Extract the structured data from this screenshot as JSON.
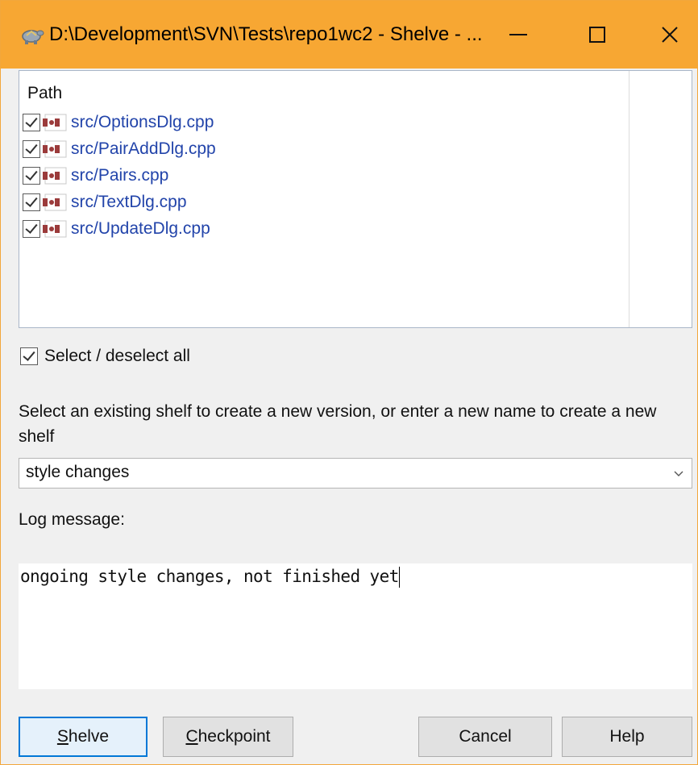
{
  "window": {
    "title": "D:\\Development\\SVN\\Tests\\repo1wc2 - Shelve - ...",
    "accent_color": "#f7a733",
    "controls": {
      "minimize_icon": "minimize-icon",
      "maximize_icon": "maximize-icon",
      "close_icon": "close-icon"
    }
  },
  "file_list": {
    "column_header": "Path",
    "files": [
      {
        "path": "src/OptionsDlg.cpp",
        "checked": true,
        "icon": "modified-file-icon"
      },
      {
        "path": "src/PairAddDlg.cpp",
        "checked": true,
        "icon": "modified-file-icon"
      },
      {
        "path": "src/Pairs.cpp",
        "checked": true,
        "icon": "modified-file-icon"
      },
      {
        "path": "src/TextDlg.cpp",
        "checked": true,
        "icon": "modified-file-icon"
      },
      {
        "path": "src/UpdateDlg.cpp",
        "checked": true,
        "icon": "modified-file-icon"
      }
    ],
    "file_color": "#2244aa"
  },
  "select_all": {
    "label": "Select / deselect all",
    "checked": true
  },
  "shelf": {
    "instructions": "Select an existing shelf to create a new version, or enter a new name to create a new shelf",
    "selected": "style changes"
  },
  "log": {
    "label": "Log message:",
    "value": "ongoing style changes, not finished yet"
  },
  "buttons": {
    "shelve": "Shelve",
    "checkpoint": "Checkpoint",
    "cancel": "Cancel",
    "help": "Help"
  }
}
